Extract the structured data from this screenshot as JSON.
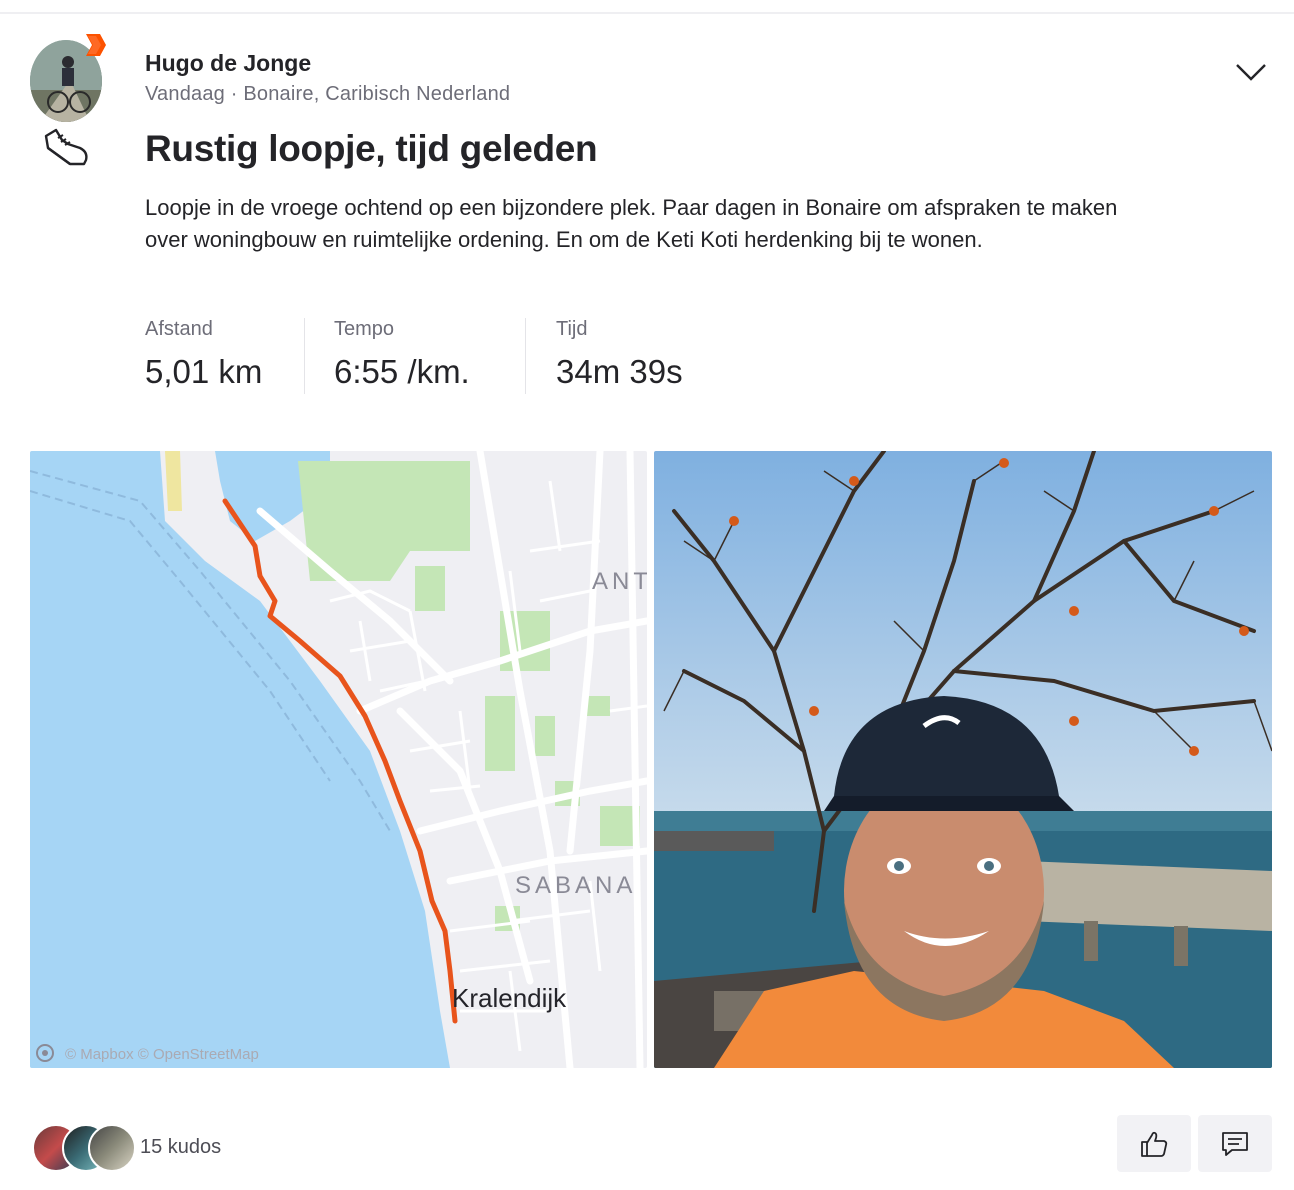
{
  "activity": {
    "athlete_name": "Hugo de Jonge",
    "meta": "Vandaag · Bonaire, Caribisch Nederland",
    "title": "Rustig loopje, tijd geleden",
    "description": "Loopje in de vroege ochtend op een bijzondere plek. Paar dagen in Bonaire om afspraken te maken over woningbouw en ruimtelijke ordening. En om de Keti Koti herdenking bij te wonen.",
    "sport_icon": "running-shoe-icon",
    "stats": [
      {
        "label": "Afstand",
        "value": "5,01 km"
      },
      {
        "label": "Tempo",
        "value": "6:55 /km."
      },
      {
        "label": "Tijd",
        "value": "34m 39s"
      }
    ]
  },
  "map": {
    "labels": {
      "district_1": "ANT",
      "district_2": "SABANA",
      "city": "Kralendijk"
    },
    "attribution": "© Mapbox © OpenStreetMap",
    "route_color": "#e8541c",
    "water_color": "#a6d5f5",
    "land_color": "#efeff3",
    "park_color": "#c4e6b6"
  },
  "footer": {
    "kudos_text": "15 kudos",
    "like_icon": "thumbs-up-icon",
    "comment_icon": "comment-icon"
  },
  "colors": {
    "brand": "#fc5200",
    "text": "#242428",
    "muted": "#6d6d78"
  }
}
